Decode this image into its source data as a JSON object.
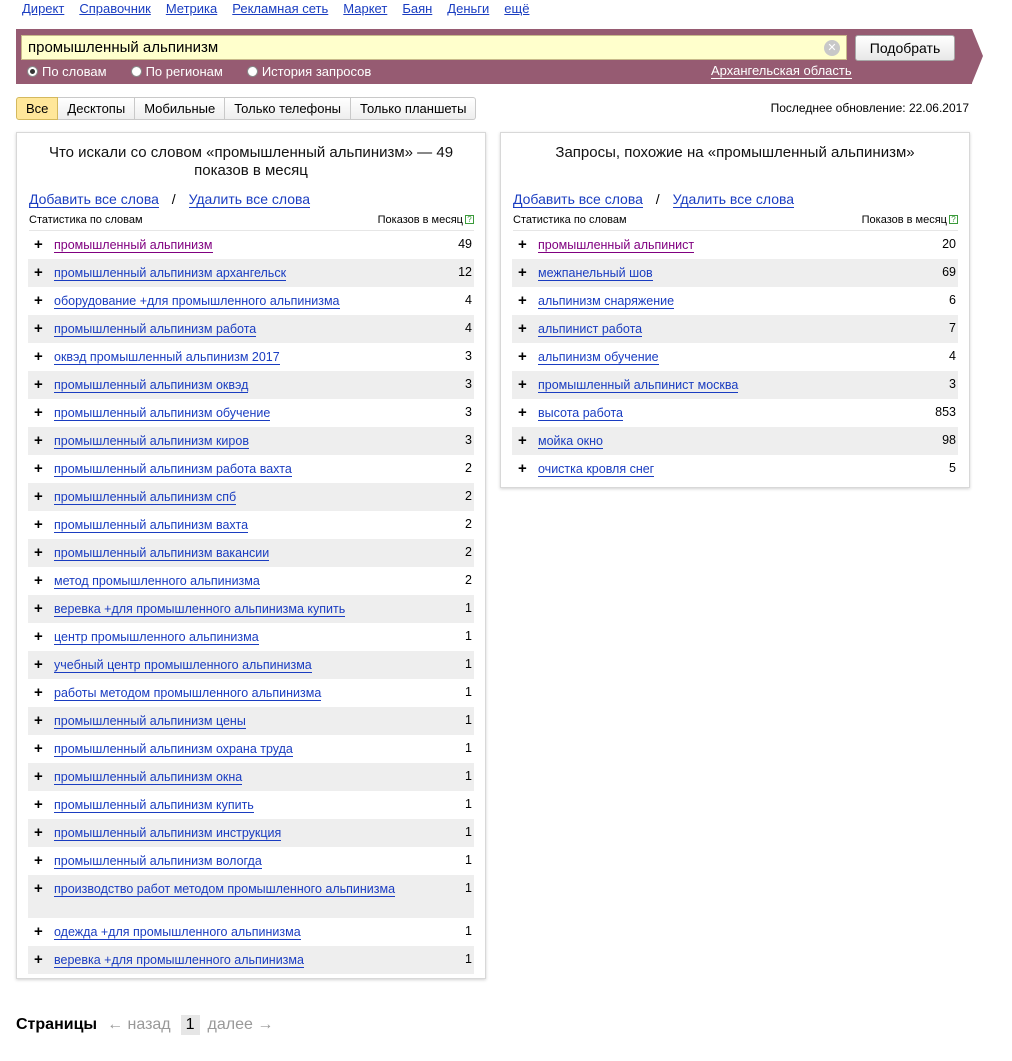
{
  "topnav": [
    "Директ",
    "Справочник",
    "Метрика",
    "Рекламная сеть",
    "Маркет",
    "Баян",
    "Деньги",
    "ещё"
  ],
  "search": {
    "value": "промышленный альпинизм",
    "clear_glyph": "✕",
    "submit_label": "Подобрать",
    "modes": [
      "По словам",
      "По регионам",
      "История запросов"
    ],
    "region": "Архангельская область"
  },
  "device_tabs": [
    "Все",
    "Десктопы",
    "Мобильные",
    "Только телефоны",
    "Только планшеты"
  ],
  "last_update": "Последнее обновление: 22.06.2017",
  "left_panel": {
    "title": "Что искали со словом «промышленный альпинизм» — 49 показов в месяц",
    "add_all": "Добавить все слова",
    "sep": "/",
    "remove_all": "Удалить все слова",
    "col_phrase": "Статистика по словам",
    "col_count": "Показов в месяц",
    "rows": [
      {
        "phrase": "промышленный альпинизм",
        "count": "49"
      },
      {
        "phrase": "промышленный альпинизм архангельск",
        "count": "12"
      },
      {
        "phrase": "оборудование +для промышленного альпинизма",
        "count": "4"
      },
      {
        "phrase": "промышленный альпинизм работа",
        "count": "4"
      },
      {
        "phrase": "оквэд промышленный альпинизм 2017",
        "count": "3"
      },
      {
        "phrase": "промышленный альпинизм оквэд",
        "count": "3"
      },
      {
        "phrase": "промышленный альпинизм обучение",
        "count": "3"
      },
      {
        "phrase": "промышленный альпинизм киров",
        "count": "3"
      },
      {
        "phrase": "промышленный альпинизм работа вахта",
        "count": "2"
      },
      {
        "phrase": "промышленный альпинизм спб",
        "count": "2"
      },
      {
        "phrase": "промышленный альпинизм вахта",
        "count": "2"
      },
      {
        "phrase": "промышленный альпинизм вакансии",
        "count": "2"
      },
      {
        "phrase": "метод промышленного альпинизма",
        "count": "2"
      },
      {
        "phrase": "веревка +для промышленного альпинизма купить",
        "count": "1"
      },
      {
        "phrase": "центр промышленного альпинизма",
        "count": "1"
      },
      {
        "phrase": "учебный центр промышленного альпинизма",
        "count": "1"
      },
      {
        "phrase": "работы методом промышленного альпинизма",
        "count": "1"
      },
      {
        "phrase": "промышленный альпинизм цены",
        "count": "1"
      },
      {
        "phrase": "промышленный альпинизм охрана труда",
        "count": "1"
      },
      {
        "phrase": "промышленный альпинизм окна",
        "count": "1"
      },
      {
        "phrase": "промышленный альпинизм купить",
        "count": "1"
      },
      {
        "phrase": "промышленный альпинизм инструкция",
        "count": "1"
      },
      {
        "phrase": "промышленный альпинизм вологда",
        "count": "1"
      },
      {
        "phrase": "производство работ методом промышленного альпинизма",
        "count": "1"
      },
      {
        "phrase": "одежда +для промышленного альпинизма",
        "count": "1"
      },
      {
        "phrase": "веревка +для промышленного альпинизма",
        "count": "1"
      }
    ]
  },
  "right_panel": {
    "title": "Запросы, похожие на «промышленный альпинизм»",
    "add_all": "Добавить все слова",
    "sep": "/",
    "remove_all": "Удалить все слова",
    "col_phrase": "Статистика по словам",
    "col_count": "Показов в месяц",
    "rows": [
      {
        "phrase": "промышленный альпинист",
        "count": "20"
      },
      {
        "phrase": "межпанельный шов",
        "count": "69"
      },
      {
        "phrase": "альпинизм снаряжение",
        "count": "6"
      },
      {
        "phrase": "альпинист работа",
        "count": "7"
      },
      {
        "phrase": "альпинизм обучение",
        "count": "4"
      },
      {
        "phrase": "промышленный альпинист москва",
        "count": "3"
      },
      {
        "phrase": "высота работа",
        "count": "853"
      },
      {
        "phrase": "мойка окно",
        "count": "98"
      },
      {
        "phrase": "очистка кровля снег",
        "count": "5"
      }
    ]
  },
  "pager": {
    "title": "Страницы",
    "prev": "← назад",
    "page": "1",
    "next": "далее →"
  }
}
